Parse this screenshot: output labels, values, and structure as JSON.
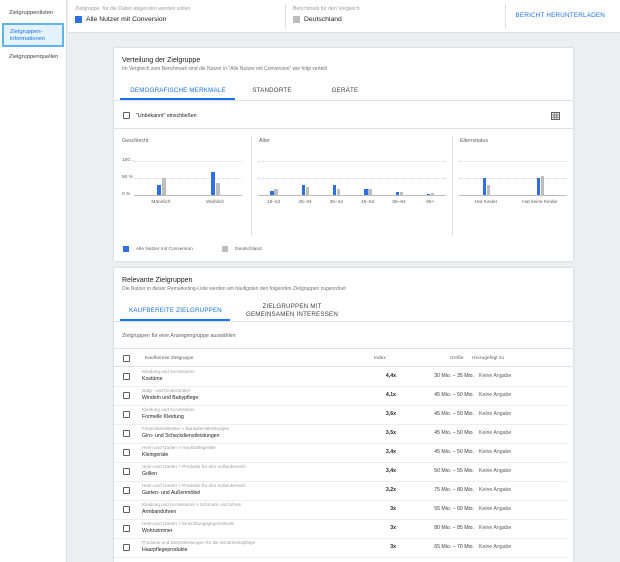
{
  "sidebar": {
    "items": [
      {
        "label": "Zielgruppenlisten"
      },
      {
        "label_line1": "Zielgruppen-",
        "label_line2": "informationen"
      },
      {
        "label": "Zielgruppenquellen"
      }
    ]
  },
  "topbar": {
    "target_label": "Zielgruppe, für die Daten abgerufen werden sollen",
    "target_value": "Alle Nutzer mit Conversion",
    "benchmark_label": "Benchmark für den Vergleich",
    "benchmark_value": "Deutschland",
    "download_label": "BERICHT HERUNTERLADEN"
  },
  "colors": {
    "primary_series": "#2f6fe4",
    "benchmark_series": "#bdbdbd",
    "accent": "#1a73e8"
  },
  "distribution": {
    "title": "Verteilung der Zielgruppe",
    "subtitle": "Im Vergleich zum Benchmark sind die Nutzer in \"Alle Nutzer mit Conversion\" wie folgt verteilt",
    "tabs": [
      "DEMOGRAFISCHE MERKMALE",
      "STANDORTE",
      "GERÄTE"
    ],
    "unknown_label": "\"Unbekannt\" einschließen",
    "table_icon": "table-grid-icon"
  },
  "chart_data": [
    {
      "type": "bar",
      "title": "Geschlecht",
      "categories": [
        "Männlich",
        "Weiblich"
      ],
      "yticks": [
        "100…",
        "50 %",
        "0 %"
      ],
      "ylim": [
        0,
        100
      ],
      "series": [
        {
          "name": "Alle Nutzer mit Conversion",
          "values": [
            28,
            68
          ]
        },
        {
          "name": "Deutschland",
          "values": [
            49,
            34
          ]
        }
      ]
    },
    {
      "type": "bar",
      "title": "Alter",
      "categories": [
        "18–24",
        "25–34",
        "35–44",
        "45–54",
        "55–64",
        "65+"
      ],
      "ylim": [
        0,
        100
      ],
      "series": [
        {
          "name": "Alle Nutzer mit Conversion",
          "values": [
            13,
            29,
            28,
            19,
            10,
            4
          ]
        },
        {
          "name": "Deutschland",
          "values": [
            18,
            25,
            19,
            17,
            9,
            6
          ]
        }
      ]
    },
    {
      "type": "bar",
      "title": "Elternstatus",
      "categories": [
        "Hat Kinder",
        "Hat keine Kinder"
      ],
      "ylim": [
        0,
        100
      ],
      "series": [
        {
          "name": "Alle Nutzer mit Conversion",
          "values": [
            51,
            49
          ]
        },
        {
          "name": "Deutschland",
          "values": [
            29,
            57
          ]
        }
      ]
    }
  ],
  "legend": [
    "Alle Nutzer mit Conversion",
    "Deutschland"
  ],
  "relevant": {
    "title": "Relevante Zielgruppen",
    "subtitle": "Die Nutzer in dieser Remarketing-Liste werden am häufigsten den folgenden Zielgruppen zugeordnet",
    "tab1": "KAUFBEREITE ZIELGRUPPEN",
    "tab2_line1": "ZIELGRUPPEN MIT",
    "tab2_line2": "GEMEINSAMEN INTERESSEN",
    "hint": "Zielgruppen für eine Anzeigengruppe auswählen",
    "headers": {
      "name": "Kaufbereite Zielgruppe",
      "index": "Index",
      "size": "Größe",
      "added": "Hinzugefügt zu"
    },
    "rows": [
      {
        "category": "Kleidung und Accessoires",
        "name": "Kostüme",
        "index": "4,4x",
        "size": "30 Mio. – 35 Mio.",
        "added": "Keine Angabe"
      },
      {
        "category": "Baby- und Kinderartikel",
        "name": "Windeln und Babypflege",
        "index": "4,1x",
        "size": "45 Mio. – 50 Mio.",
        "added": "Keine Angabe"
      },
      {
        "category": "Kleidung und Accessoires",
        "name": "Formelle Kleidung",
        "index": "3,6x",
        "size": "45 Mio. – 50 Mio.",
        "added": "Keine Angabe"
      },
      {
        "category": "Finanzdienstleister > Bankdienstleistungen",
        "name": "Giro- und Scheckdienstleistungen",
        "index": "3,5x",
        "size": "45 Mio. – 50 Mio.",
        "added": "Keine Angabe"
      },
      {
        "category": "Heim und Garten > Haushaltsgeräte",
        "name": "Kleingeräte",
        "index": "3,4x",
        "size": "45 Mio. – 50 Mio.",
        "added": "Keine Angabe"
      },
      {
        "category": "Heim und Garten > Produkte für den Außenbereich",
        "name": "Grillen",
        "index": "3,4x",
        "size": "50 Mio. – 55 Mio.",
        "added": "Keine Angabe"
      },
      {
        "category": "Heim und Garten > Produkte für den Außenbereich",
        "name": "Garten- und Außenmöbel",
        "index": "3,2x",
        "size": "75 Mio. – 80 Mio.",
        "added": "Keine Angabe"
      },
      {
        "category": "Kleidung und Accessoires > Schmuck und Uhren",
        "name": "Armbanduhren",
        "index": "3x",
        "size": "55 Mio. – 60 Mio.",
        "added": "Keine Angabe"
      },
      {
        "category": "Heim und Garten > Einrichtungsgegenstände",
        "name": "Wohnzimmer",
        "index": "3x",
        "size": "80 Mio. – 85 Mio.",
        "added": "Keine Angabe"
      },
      {
        "category": "Produkte und Dienstleistungen für die Schönheitspflege",
        "name": "Haarpflegeprodukte",
        "index": "3x",
        "size": "65 Mio. – 70 Mio.",
        "added": "Keine Angabe"
      }
    ]
  }
}
